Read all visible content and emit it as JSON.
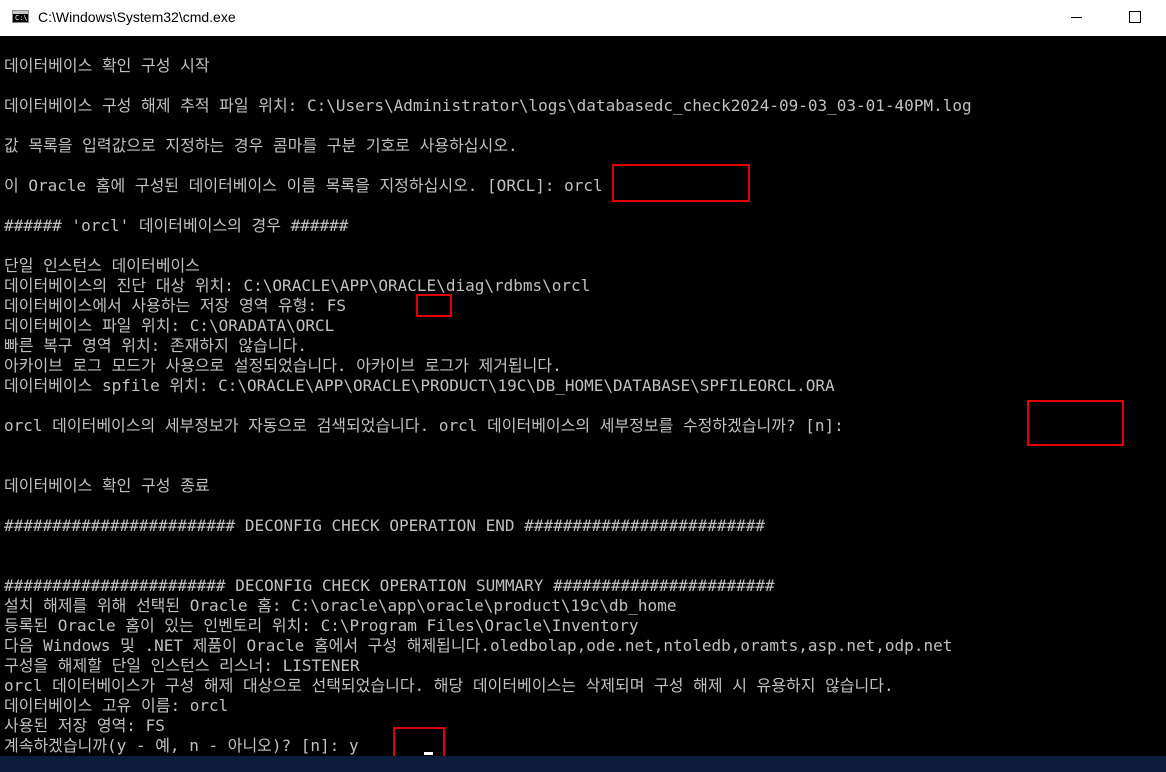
{
  "window": {
    "title": "C:\\Windows\\System32\\cmd.exe",
    "icon": "cmd-icon",
    "icon_glyph": "C:\\",
    "controls": [
      "minimize-icon",
      "maximize-icon"
    ]
  },
  "console": {
    "lines": [
      "데이터베이스 확인 구성 시작",
      "데이터베이스 구성 해제 추적 파일 위치: C:\\Users\\Administrator\\logs\\databasedc_check2024-09-03_03-01-40PM.log",
      "값 목록을 입력값으로 지정하는 경우 콤마를 구분 기호로 사용하십시오.",
      "이 Oracle 홈에 구성된 데이터베이스 이름 목록을 지정하십시오. [ORCL]: orcl",
      "###### 'orcl' 데이터베이스의 경우 ######",
      "단일 인스턴스 데이터베이스",
      "데이터베이스의 진단 대상 위치: C:\\ORACLE\\APP\\ORACLE\\diag\\rdbms\\orcl",
      "데이터베이스에서 사용하는 저장 영역 유형: FS",
      "데이터베이스 파일 위치: C:\\ORADATA\\ORCL",
      "빠른 복구 영역 위치: 존재하지 않습니다.",
      "아카이브 로그 모드가 사용으로 설정되었습니다. 아카이브 로그가 제거됩니다.",
      "데이터베이스 spfile 위치: C:\\ORACLE\\APP\\ORACLE\\PRODUCT\\19C\\DB_HOME\\DATABASE\\SPFILEORCL.ORA",
      "orcl 데이터베이스의 세부정보가 자동으로 검색되었습니다. orcl 데이터베이스의 세부정보를 수정하겠습니까? [n]:",
      "데이터베이스 확인 구성 종료",
      "######################## DECONFIG CHECK OPERATION END #########################",
      "####################### DECONFIG CHECK OPERATION SUMMARY #######################",
      "설치 해제를 위해 선택된 Oracle 홈: C:\\oracle\\app\\oracle\\product\\19c\\db_home",
      "등록된 Oracle 홈이 있는 인벤토리 위치: C:\\Program Files\\Oracle\\Inventory",
      "다음 Windows 및 .NET 제품이 Oracle 홈에서 구성 해제됩니다.oledbolap,ode.net,ntoledb,oramts,asp.net,odp.net",
      "구성을 해제할 단일 인스턴스 리스너: LISTENER",
      "orcl 데이터베이스가 구성 해제 대상으로 선택되었습니다. 해당 데이터베이스는 삭제되며 구성 해제 시 유용하지 않습니다.",
      "데이터베이스 고유 이름: orcl",
      "사용된 저장 영역: FS",
      "계속하겠습니까(y - 예, n - 아니오)? [n]: y"
    ]
  },
  "annotations": {
    "highlight_color": "#e00000"
  }
}
